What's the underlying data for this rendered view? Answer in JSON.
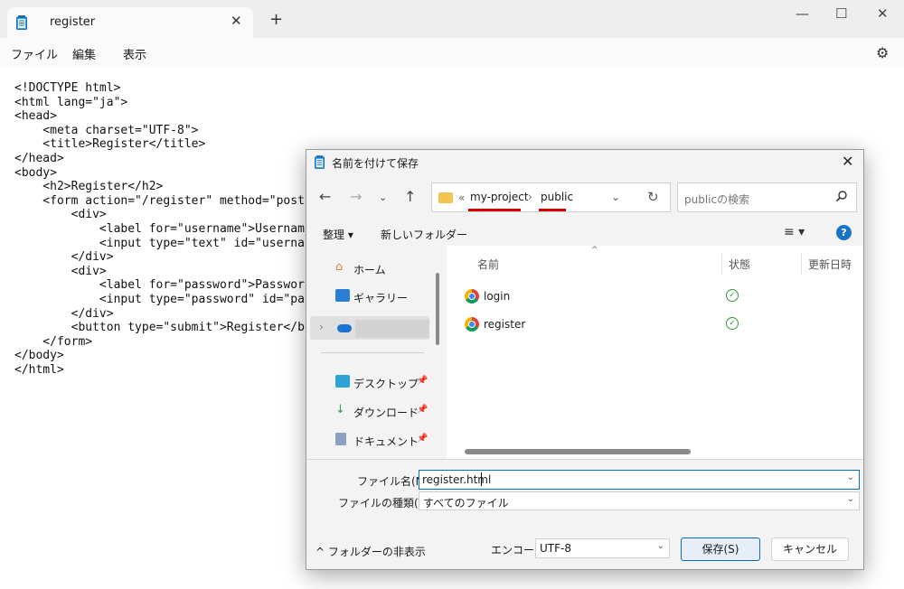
{
  "notepad": {
    "tab_title": "register",
    "menu": [
      "ファイル",
      "編集",
      "表示"
    ],
    "code_lines": [
      "<!DOCTYPE html>",
      "<html lang=\"ja\">",
      "<head>",
      "    <meta charset=\"UTF-8\">",
      "    <title>Register</title>",
      "</head>",
      "<body>",
      "    <h2>Register</h2>",
      "    <form action=\"/register\" method=\"post",
      "        <div>",
      "            <label for=\"username\">Usernam",
      "            <input type=\"text\" id=\"userna",
      "        </div>",
      "        <div>",
      "            <label for=\"password\">Passwor",
      "            <input type=\"password\" id=\"pa",
      "        </div>",
      "        <button type=\"submit\">Register</b",
      "    </form>",
      "</body>",
      "</html>"
    ]
  },
  "dialog": {
    "title": "名前を付けて保存",
    "address": {
      "overflow": "«",
      "crumbs": [
        "my-project",
        "public"
      ]
    },
    "search_placeholder": "publicの検索",
    "toolbar": {
      "organize": "整理 ▾",
      "new_folder": "新しいフォルダー"
    },
    "nav": {
      "home": "ホーム",
      "gallery": "ギャラリー",
      "desktop": "デスクトップ",
      "downloads": "ダウンロード",
      "documents": "ドキュメント"
    },
    "columns": {
      "name": "名前",
      "status": "状態",
      "modified": "更新日時"
    },
    "files": [
      {
        "name": "login",
        "status": "synced"
      },
      {
        "name": "register",
        "status": "synced"
      }
    ],
    "filename_label": "ファイル名(N):",
    "filename_value": "register.html",
    "filetype_label": "ファイルの種類(T):",
    "filetype_value": "すべてのファイル",
    "hide_folders": "フォルダーの非表示",
    "encoding_label": "エンコード:",
    "encoding_value": "UTF-8",
    "save_label": "保存(S)",
    "cancel_label": "キャンセル"
  },
  "colors": {
    "accent": "#0b6cc2",
    "underline": "#d20000",
    "status_ok": "#2e9c3c"
  }
}
